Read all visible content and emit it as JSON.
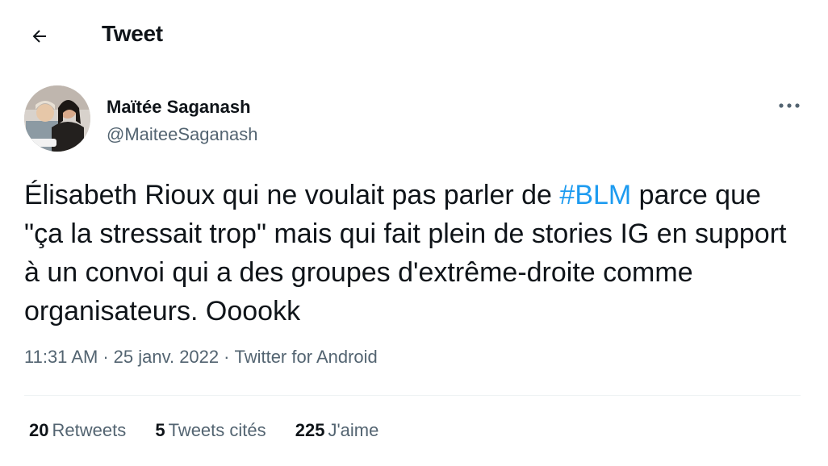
{
  "header": {
    "title": "Tweet",
    "back_icon": "arrow-left-icon"
  },
  "author": {
    "name": "Maïtée Saganash",
    "handle": "@MaiteeSaganash",
    "more_icon": "more-horizontal-icon"
  },
  "tweet": {
    "text_before": "Élisabeth Rioux qui ne voulait pas parler de ",
    "hashtag": "#BLM",
    "text_after": " parce que \"ça la stressait trop\" mais qui fait plein de stories IG en support à un convoi qui a des groupes d'extrême-droite comme organisateurs. Ooookk",
    "hashtag_color": "#1d9bf0"
  },
  "meta": {
    "time": "11:31 AM",
    "separator": "·",
    "date": "25 janv. 2022",
    "source": "Twitter for Android"
  },
  "stats": [
    {
      "count": "20",
      "label": "Retweets"
    },
    {
      "count": "5",
      "label": "Tweets cités"
    },
    {
      "count": "225",
      "label": "J'aime"
    }
  ],
  "colors": {
    "text": "#0f1419",
    "secondary": "#536471",
    "accent": "#1d9bf0",
    "divider": "#eff3f4"
  }
}
